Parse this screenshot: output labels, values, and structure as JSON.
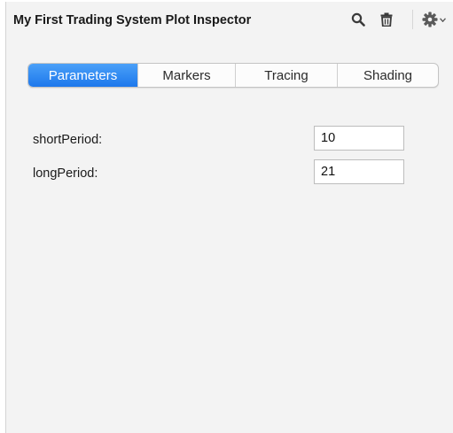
{
  "header": {
    "title": "My First Trading System Plot Inspector",
    "icons": [
      "search-icon",
      "trash-icon",
      "gear-icon",
      "chevron-down-icon"
    ]
  },
  "tabs": [
    {
      "label": "Parameters",
      "active": true
    },
    {
      "label": "Markers",
      "active": false
    },
    {
      "label": "Tracing",
      "active": false
    },
    {
      "label": "Shading",
      "active": false
    }
  ],
  "parameters": [
    {
      "label": "shortPeriod:",
      "value": "10"
    },
    {
      "label": "longPeriod:",
      "value": "21"
    }
  ],
  "colors": {
    "accent": "#1d78ec",
    "panel_bg": "#f3f3f3"
  }
}
